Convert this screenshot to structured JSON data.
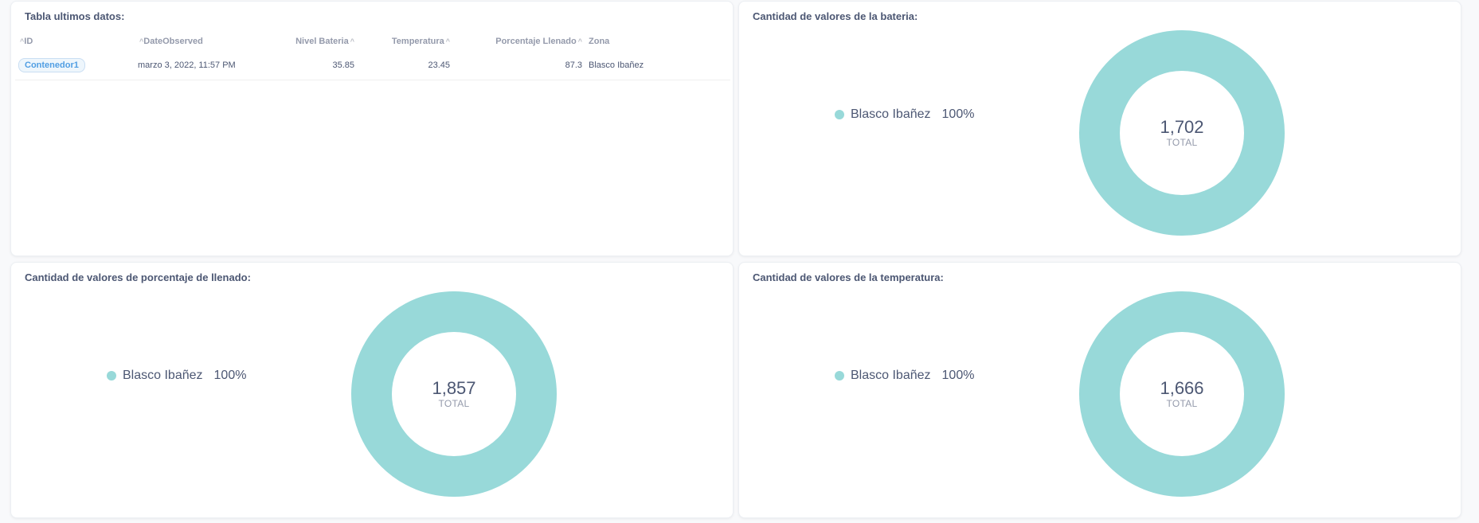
{
  "colors": {
    "slice": "#98d9d9",
    "pill_text": "#509ee3"
  },
  "table_card": {
    "title": "Tabla ultimos datos:",
    "columns": [
      "ID",
      "DateObserved",
      "Nivel Bateria",
      "Temperatura",
      "Porcentaje Llenado",
      "Zona"
    ],
    "rows": [
      [
        "Contenedor1",
        "marzo 3, 2022, 11:57 PM",
        "35.85",
        "23.45",
        "87.3",
        "Blasco Ibañez"
      ]
    ]
  },
  "bateria_card": {
    "title": "Cantidad de valores de la bateria:",
    "legend_name": "Blasco Ibañez",
    "legend_pct": "100%",
    "total_value": "1,702",
    "total_label": "TOTAL"
  },
  "llenado_card": {
    "title": "Cantidad de valores de porcentaje de llenado:",
    "legend_name": "Blasco Ibañez",
    "legend_pct": "100%",
    "total_value": "1,857",
    "total_label": "TOTAL"
  },
  "temp_card": {
    "title": "Cantidad de valores de la temperatura:",
    "legend_name": "Blasco Ibañez",
    "legend_pct": "100%",
    "total_value": "1,666",
    "total_label": "TOTAL"
  },
  "chart_data": [
    {
      "type": "pie",
      "title": "Cantidad de valores de la bateria:",
      "categories": [
        "Blasco Ibañez"
      ],
      "values": [
        1702
      ],
      "percentages": [
        "100%"
      ]
    },
    {
      "type": "pie",
      "title": "Cantidad de valores de porcentaje de llenado:",
      "categories": [
        "Blasco Ibañez"
      ],
      "values": [
        1857
      ],
      "percentages": [
        "100%"
      ]
    },
    {
      "type": "pie",
      "title": "Cantidad de valores de la temperatura:",
      "categories": [
        "Blasco Ibañez"
      ],
      "values": [
        1666
      ],
      "percentages": [
        "100%"
      ]
    }
  ]
}
